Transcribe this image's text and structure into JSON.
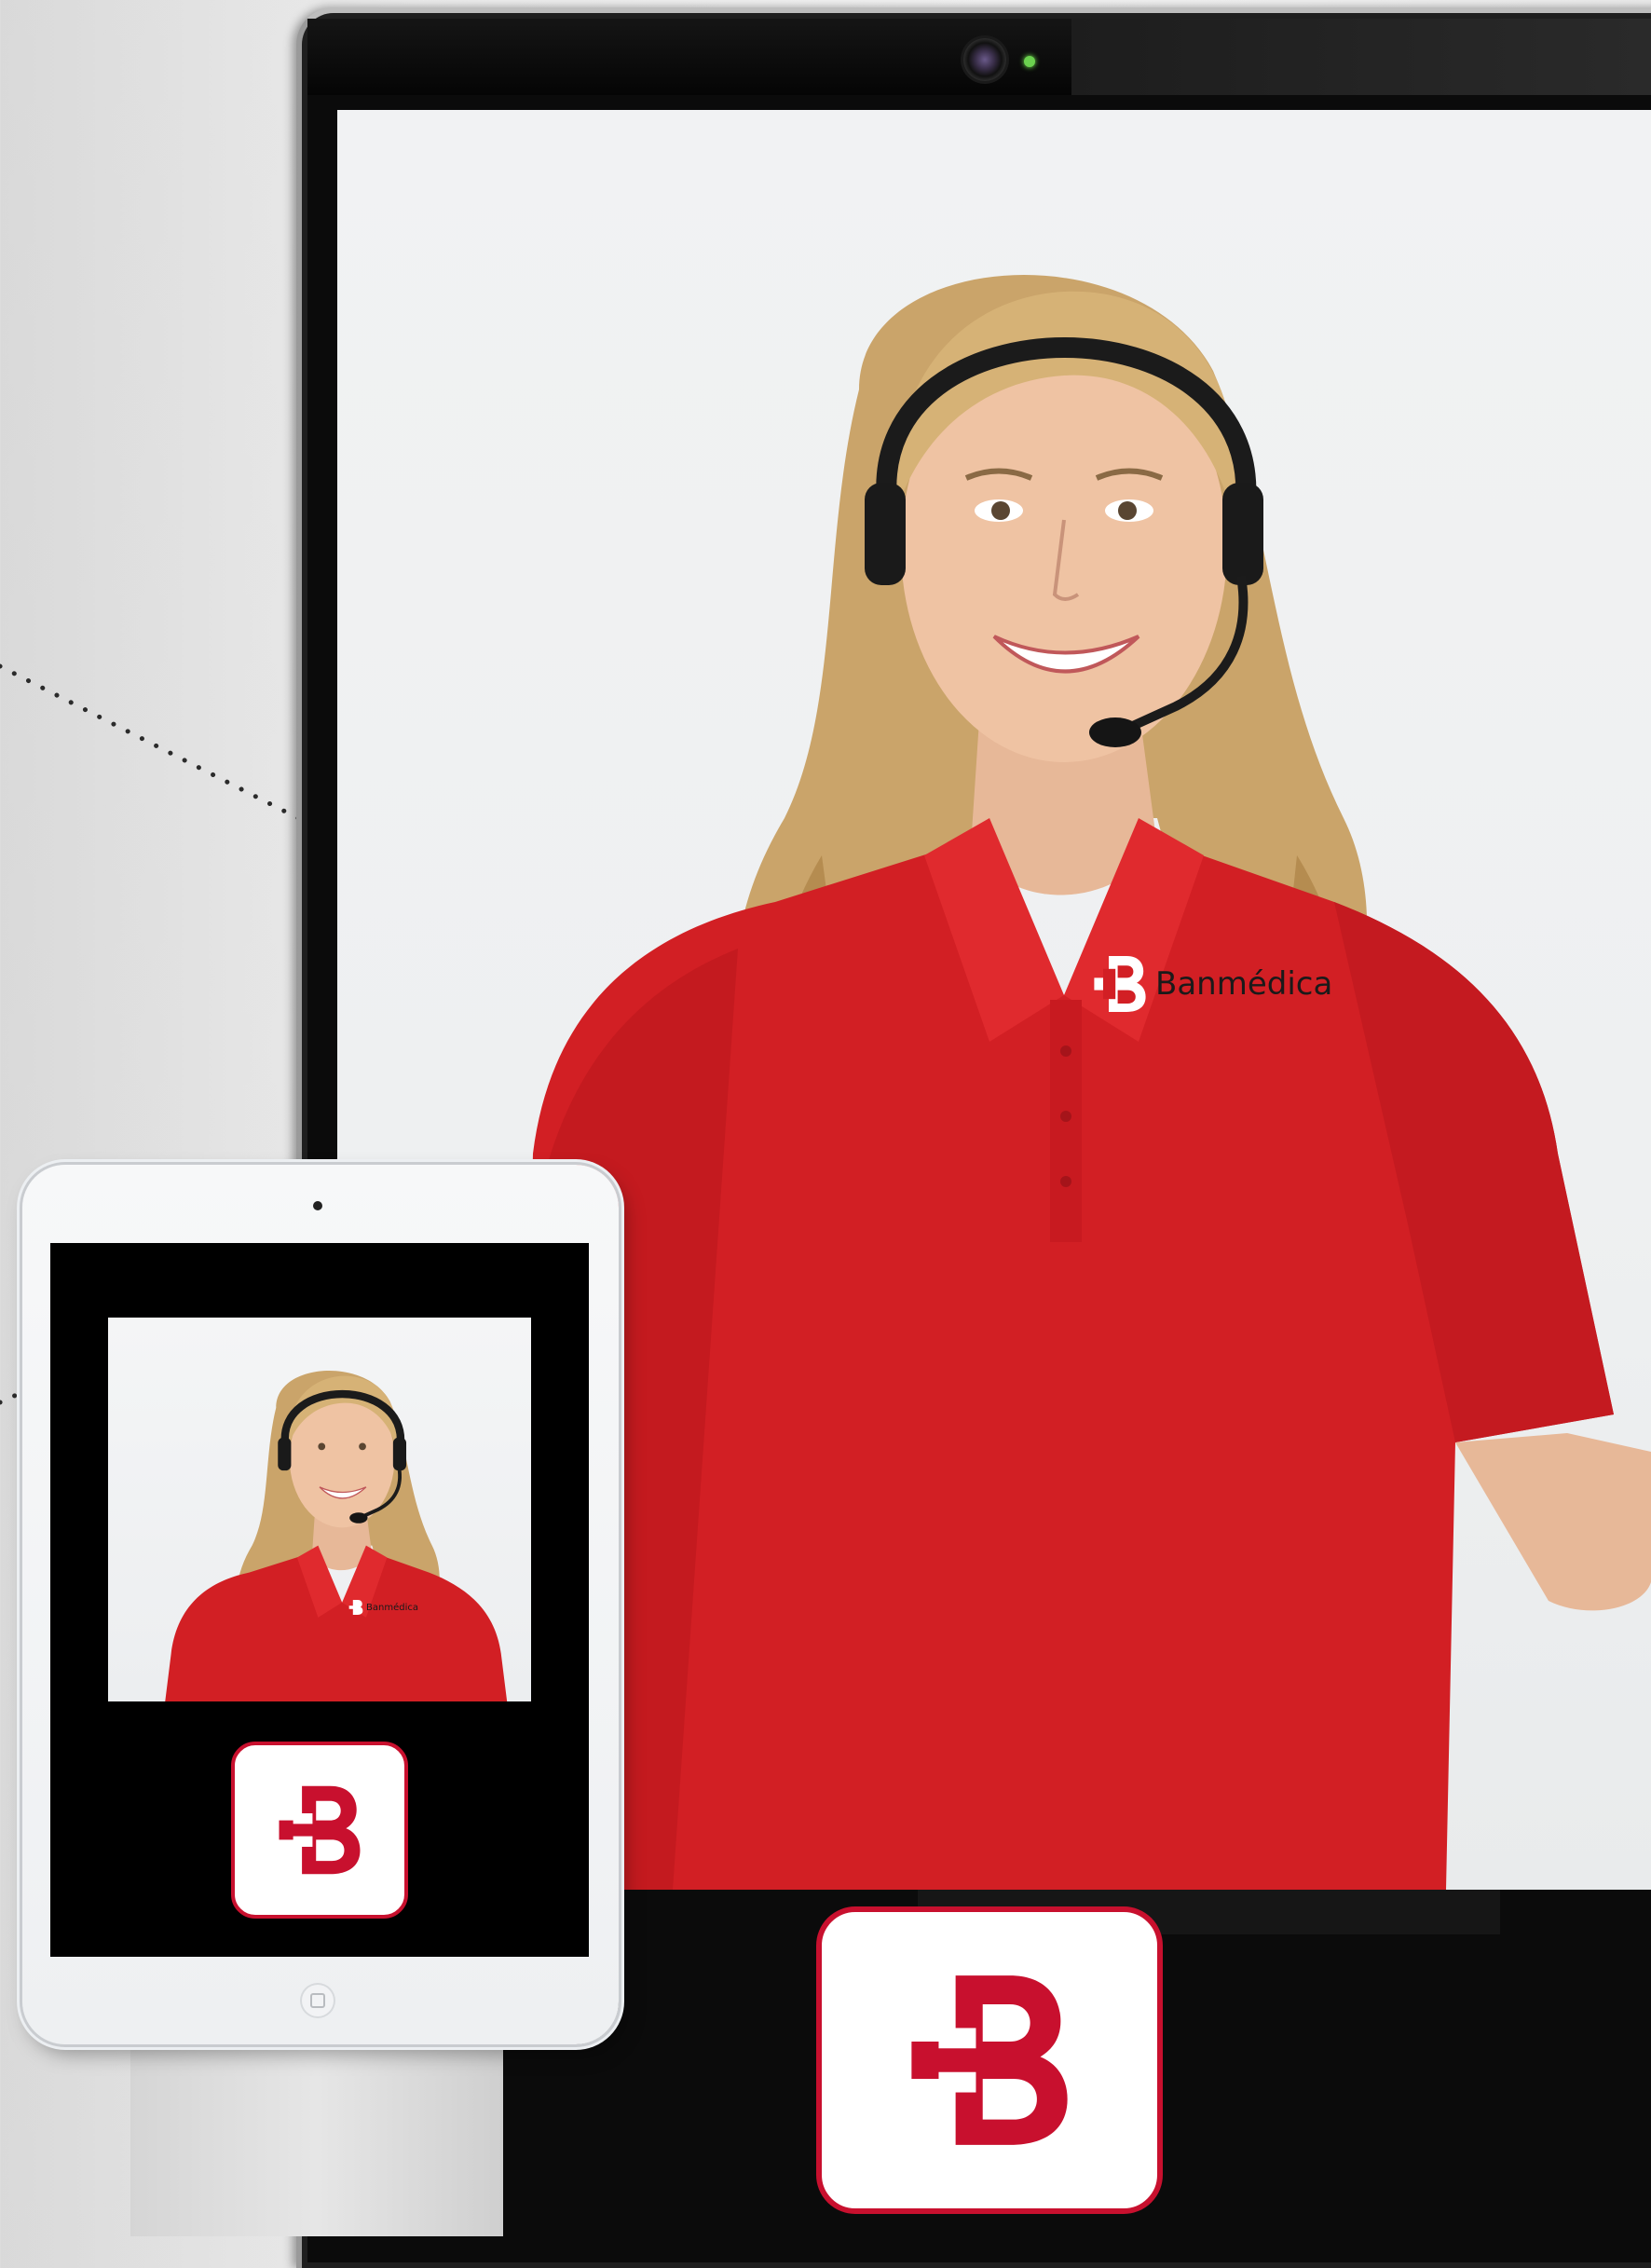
{
  "brand": {
    "name": "Banmédica",
    "colors": {
      "primary_red": "#c8102e",
      "shirt_red": "#d21f24",
      "white": "#ffffff",
      "bezel": "#0b0b0b"
    },
    "logo_icon": "banmedica-b-cross-icon"
  },
  "kiosk": {
    "camera_icon": "webcam-icon",
    "status_led": "green"
  },
  "tablet": {
    "home_icon": "home-button-icon"
  }
}
